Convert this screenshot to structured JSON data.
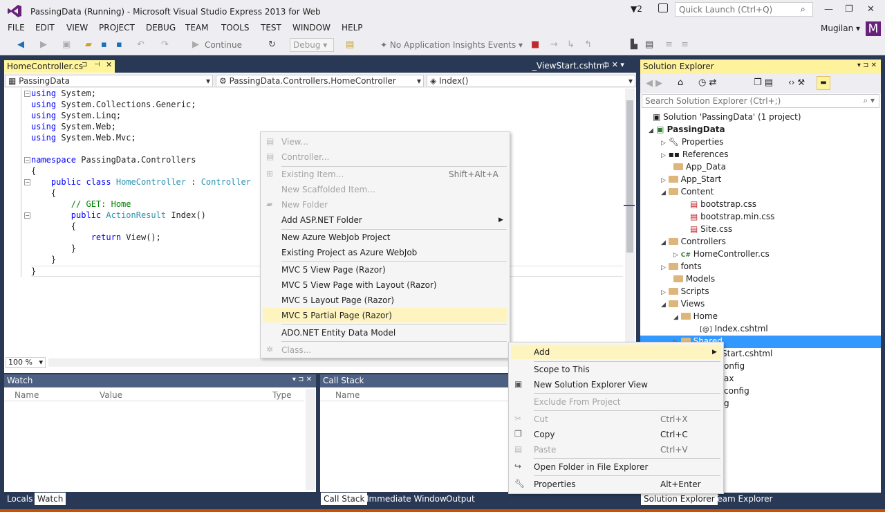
{
  "window": {
    "title": "PassingData (Running) - Microsoft Visual Studio Express 2013 for Web",
    "flag_count": "2",
    "quick_launch": "Quick Launch (Ctrl+Q)"
  },
  "menubar": [
    "FILE",
    "EDIT",
    "VIEW",
    "PROJECT",
    "DEBUG",
    "TEAM",
    "TOOLS",
    "TEST",
    "WINDOW",
    "HELP"
  ],
  "user": {
    "name": "Mugilan",
    "initial": "M"
  },
  "toolbar": {
    "continue": "Continue",
    "debug_config": "Debug",
    "insights": "No Application Insights Events"
  },
  "tabs": {
    "active": "HomeController.cs",
    "preview": "_ViewStart.cshtml"
  },
  "nav": {
    "project": "PassingData",
    "class": "PassingData.Controllers.HomeController",
    "member": "Index()"
  },
  "code": {
    "u1": "System;",
    "u2": "System.Collections.Generic;",
    "u3": "System.Linq;",
    "u4": "System.Web;",
    "u5": "System.Web.Mvc;",
    "using": "using",
    "namespace_kw": "namespace",
    "ns": "PassingData.Controllers",
    "brace_open": "{",
    "brace_close": "}",
    "public_class": "public class",
    "controller_name": "HomeController",
    "colon": ":",
    "base": "Controller",
    "comment": "// GET: Home",
    "public": "public",
    "action_result": "ActionResult",
    "method": "Index()",
    "return_kw": "return",
    "view_call": "View();"
  },
  "zoom": "100 %",
  "watch": {
    "title": "Watch",
    "cols": [
      "Name",
      "Value",
      "Type"
    ]
  },
  "callstack": {
    "title": "Call Stack",
    "cols": [
      "Name"
    ]
  },
  "bottom_tabs_left": [
    "Locals",
    "Watch"
  ],
  "bottom_tabs_mid": [
    "Call Stack",
    "Immediate Window",
    "Output"
  ],
  "bottom_tabs_right": [
    "Solution Explorer",
    "Team Explorer"
  ],
  "solution_explorer": {
    "title": "Solution Explorer",
    "search": "Search Solution Explorer (Ctrl+;)",
    "solution": "Solution 'PassingData' (1 project)",
    "project": "PassingData",
    "items": [
      "Properties",
      "References",
      "App_Data",
      "App_Start",
      "Content",
      "bootstrap.css",
      "bootstrap.min.css",
      "Site.css",
      "Controllers",
      "HomeController.cs",
      "fonts",
      "Models",
      "Scripts",
      "Views",
      "Home",
      "Index.cshtml",
      "Shared"
    ],
    "partial": [
      "Start.cshtml",
      "onfig",
      "ax",
      "config",
      "g"
    ]
  },
  "add_menu": {
    "items": [
      "View...",
      "Controller...",
      "Existing Item...",
      "New Scaffolded Item...",
      "New Folder",
      "Add ASP.NET Folder",
      "New Azure WebJob Project",
      "Existing Project as Azure WebJob",
      "MVC 5 View Page (Razor)",
      "MVC 5 View Page with Layout (Razor)",
      "MVC 5 Layout Page (Razor)",
      "MVC 5 Partial Page (Razor)",
      "ADO.NET Entity Data Model",
      "Class..."
    ],
    "shortcut_existing": "Shift+Alt+A"
  },
  "context_menu": {
    "items": [
      "Add",
      "Scope to This",
      "New Solution Explorer View",
      "Exclude From Project",
      "Cut",
      "Copy",
      "Paste",
      "Open Folder in File Explorer",
      "Properties"
    ],
    "shortcuts": {
      "cut": "Ctrl+X",
      "copy": "Ctrl+C",
      "paste": "Ctrl+V",
      "properties": "Alt+Enter"
    }
  },
  "colors": {
    "accent": "#68217a",
    "panel_header": "#4d6082",
    "highlight": "#fff29d",
    "selection": "#3399ff"
  },
  "icons": [
    "vs-logo-icon",
    "filter-icon",
    "feedback-icon",
    "search-icon",
    "minimize-icon",
    "maximize-icon",
    "close-icon",
    "play-icon",
    "stop-icon",
    "pin-icon",
    "folder-icon",
    "chevron-right-icon"
  ]
}
